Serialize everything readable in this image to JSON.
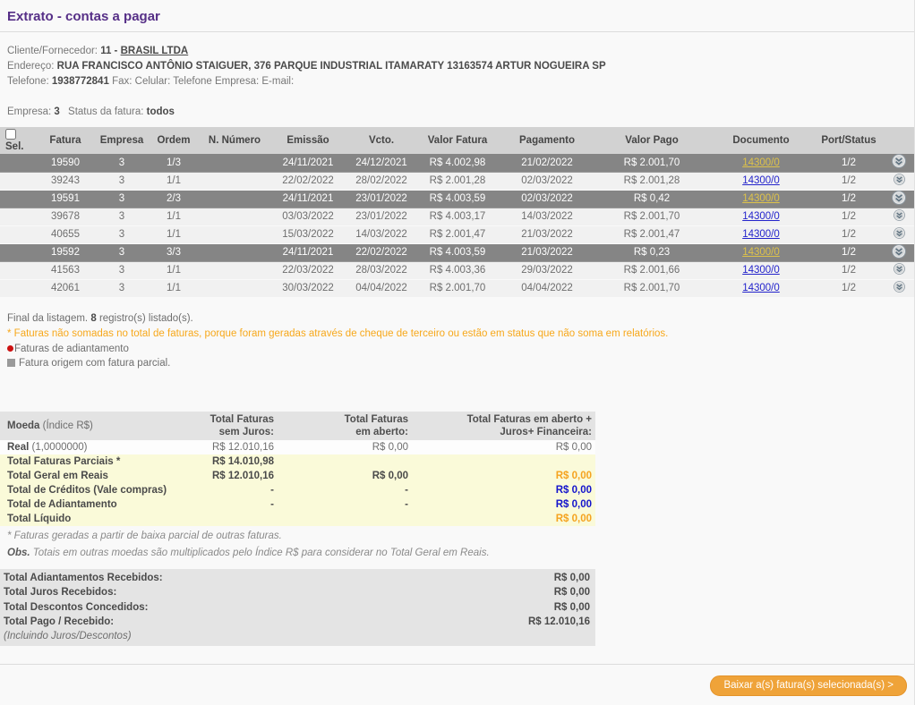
{
  "header": {
    "title": "Extrato - contas a pagar"
  },
  "client": {
    "fornecedor_label": "Cliente/Fornecedor:",
    "fornecedor_code": "11 -",
    "fornecedor_name": "BRASIL LTDA",
    "endereco_label": "Endereço:",
    "endereco": "RUA FRANCISCO ANTÔNIO STAIGUER, 376 PARQUE INDUSTRIAL ITAMARATY 13163574 ARTUR NOGUEIRA SP",
    "telefone_label": "Telefone:",
    "telefone": "1938772841",
    "fax_label": "Fax:",
    "celular_label": "Celular:",
    "telefone_empresa_label": "Telefone Empresa:",
    "email_label": "E-mail:"
  },
  "filter": {
    "empresa_label": "Empresa:",
    "empresa": "3",
    "status_label": "Status da fatura:",
    "status": "todos"
  },
  "invoice_table": {
    "columns": [
      "Sel.",
      "Fatura",
      "Empresa",
      "Ordem",
      "N. Número",
      "Emissão",
      "Vcto.",
      "Valor Fatura",
      "Pagamento",
      "Valor Pago",
      "Documento",
      "Port/Status"
    ],
    "rows": [
      {
        "fatura": "19590",
        "empresa": "3",
        "ordem": "1/3",
        "n_numero": "",
        "emissao": "24/11/2021",
        "vcto": "24/12/2021",
        "valor_fatura": "R$ 4.002,98",
        "pagamento": "21/02/2022",
        "valor_pago": "R$ 2.001,70",
        "documento": "14300/0",
        "port_status": "1/2",
        "highlight": true
      },
      {
        "fatura": "39243",
        "empresa": "3",
        "ordem": "1/1",
        "n_numero": "",
        "emissao": "22/02/2022",
        "vcto": "28/02/2022",
        "valor_fatura": "R$ 2.001,28",
        "pagamento": "02/03/2022",
        "valor_pago": "R$ 2.001,28",
        "documento": "14300/0",
        "port_status": "1/2",
        "highlight": false
      },
      {
        "fatura": "19591",
        "empresa": "3",
        "ordem": "2/3",
        "n_numero": "",
        "emissao": "24/11/2021",
        "vcto": "23/01/2022",
        "valor_fatura": "R$ 4.003,59",
        "pagamento": "02/03/2022",
        "valor_pago": "R$ 0,42",
        "documento": "14300/0",
        "port_status": "1/2",
        "highlight": true
      },
      {
        "fatura": "39678",
        "empresa": "3",
        "ordem": "1/1",
        "n_numero": "",
        "emissao": "03/03/2022",
        "vcto": "23/01/2022",
        "valor_fatura": "R$ 4.003,17",
        "pagamento": "14/03/2022",
        "valor_pago": "R$ 2.001,70",
        "documento": "14300/0",
        "port_status": "1/2",
        "highlight": false
      },
      {
        "fatura": "40655",
        "empresa": "3",
        "ordem": "1/1",
        "n_numero": "",
        "emissao": "15/03/2022",
        "vcto": "14/03/2022",
        "valor_fatura": "R$ 2.001,47",
        "pagamento": "21/03/2022",
        "valor_pago": "R$ 2.001,47",
        "documento": "14300/0",
        "port_status": "1/2",
        "highlight": false
      },
      {
        "fatura": "19592",
        "empresa": "3",
        "ordem": "3/3",
        "n_numero": "",
        "emissao": "24/11/2021",
        "vcto": "22/02/2022",
        "valor_fatura": "R$ 4.003,59",
        "pagamento": "21/03/2022",
        "valor_pago": "R$ 0,23",
        "documento": "14300/0",
        "port_status": "1/2",
        "highlight": true
      },
      {
        "fatura": "41563",
        "empresa": "3",
        "ordem": "1/1",
        "n_numero": "",
        "emissao": "22/03/2022",
        "vcto": "28/03/2022",
        "valor_fatura": "R$ 4.003,36",
        "pagamento": "29/03/2022",
        "valor_pago": "R$ 2.001,66",
        "documento": "14300/0",
        "port_status": "1/2",
        "highlight": false
      },
      {
        "fatura": "42061",
        "empresa": "3",
        "ordem": "1/1",
        "n_numero": "",
        "emissao": "30/03/2022",
        "vcto": "04/04/2022",
        "valor_fatura": "R$ 2.001,70",
        "pagamento": "04/04/2022",
        "valor_pago": "R$ 2.001,70",
        "documento": "14300/0",
        "port_status": "1/2",
        "highlight": false
      }
    ]
  },
  "list_footer": {
    "text1": "Final da listagem.",
    "count": "8",
    "text2": "registro(s) listado(s)."
  },
  "notes": {
    "orange": "* Faturas não somadas no total de faturas, porque foram geradas através de cheque de terceiro ou estão em status que não soma em relatórios.",
    "legend_adiantamento": "Faturas de adiantamento",
    "legend_parcial": "Fatura origem com fatura parcial."
  },
  "totals_table": {
    "moeda_label": "Moeda",
    "moeda_sub": " (Índice R$)",
    "col_headers": [
      "Total Faturas\nsem Juros:",
      "Total Faturas\nem aberto:",
      "Total Faturas em aberto +\nJuros+ Financeira:"
    ],
    "rows": [
      {
        "name": "Real",
        "suffix": " (1,0000000)",
        "values": [
          "R$ 12.010,16",
          "R$ 0,00",
          "R$ 0,00"
        ],
        "style": "real",
        "last_color": ""
      },
      {
        "name": "Total Faturas Parciais *",
        "suffix": "",
        "values": [
          "R$ 14.010,98",
          "",
          ""
        ],
        "style": "yellow",
        "last_color": ""
      },
      {
        "name": "Total Geral em Reais",
        "suffix": "",
        "values": [
          "R$ 12.010,16",
          "R$ 0,00",
          "R$ 0,00"
        ],
        "style": "yellow",
        "last_color": "orange"
      },
      {
        "name": "Total de Créditos (Vale compras)",
        "suffix": "",
        "values": [
          "-",
          "-",
          "R$ 0,00"
        ],
        "style": "yellow",
        "last_color": "blue"
      },
      {
        "name": "Total de Adiantamento",
        "suffix": "",
        "values": [
          "-",
          "-",
          "R$ 0,00"
        ],
        "style": "yellow",
        "last_color": "blue"
      },
      {
        "name": "Total Líquido",
        "suffix": "",
        "values": [
          "",
          "",
          "R$ 0,00"
        ],
        "style": "yellow",
        "last_color": "orange"
      }
    ],
    "footnote": "* Faturas geradas a partir de baixa parcial de outras faturas.",
    "obs_label": "Obs.",
    "obs_text": " Totais em outras moedas são multiplicados pelo Índice R$ para considerar no Total Geral em Reais."
  },
  "summary": {
    "rows": [
      {
        "label": "Total Adiantamentos Recebidos:",
        "value": "R$ 0,00",
        "sublabel": ""
      },
      {
        "label": "Total Juros Recebidos:",
        "value": "R$ 0,00",
        "sublabel": ""
      },
      {
        "label": "Total Descontos Concedidos:",
        "value": "R$ 0,00",
        "sublabel": ""
      },
      {
        "label": "Total Pago / Recebido:",
        "value": "R$ 12.010,16",
        "sublabel": "(Incluindo Juros/Descontos)"
      }
    ]
  },
  "actions": {
    "download_button": "Baixar a(s) fatura(s) selecionada(s) >"
  },
  "colors": {
    "accent_purple": "#562f87",
    "orange": "#f5a31f",
    "link_blue": "#2424cc",
    "link_on_dark_row": "#ddc24a",
    "row_highlight_gray": "#858585",
    "value_blue": "#1414cc",
    "button_orange": "#efa339",
    "yellow_bg": "#fafad9"
  }
}
